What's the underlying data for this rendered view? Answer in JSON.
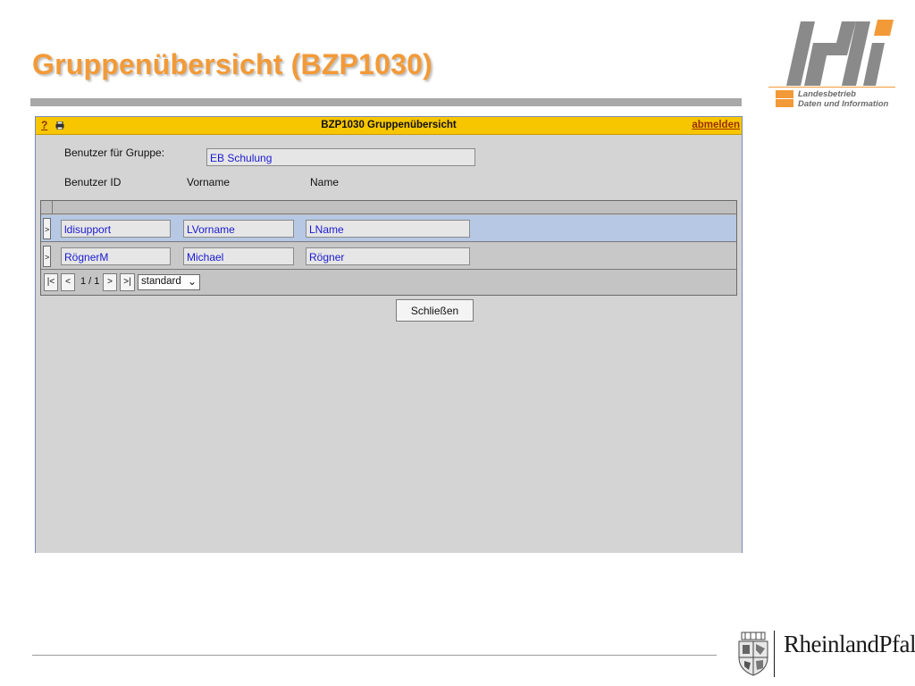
{
  "slide": {
    "title": "Gruppenübersicht (BZP1030)",
    "logo_letters": "ldi",
    "logo_line1": "Landesbetrieb",
    "logo_line2": "Daten und Information",
    "footer_logo_text": "RheinlandPfalz"
  },
  "app": {
    "help": "?",
    "title": "BZP1030 Gruppenübersicht",
    "logout": "abmelden",
    "group_label": "Benutzer für Gruppe:",
    "group_value": "EB Schulung",
    "columns": [
      "Benutzer ID",
      "Vorname",
      "Name"
    ],
    "rows": [
      {
        "marker": ">",
        "id": "ldisupport",
        "first": "LVorname",
        "last": "LName",
        "selected": true
      },
      {
        "marker": ">",
        "id": "RögnerM",
        "first": "Michael",
        "last": "Rögner",
        "selected": false
      }
    ],
    "pager": {
      "first": "|<",
      "prev": "<",
      "page": "1 / 1",
      "next": ">",
      "last": ">|",
      "view": "standard"
    },
    "close_button": "Schließen"
  },
  "colors": {
    "title_orange": "#f29a38",
    "titlebar_yellow": "#f7c600",
    "selected_row": "#b6c8e4",
    "field_text": "#1a1ad0"
  }
}
